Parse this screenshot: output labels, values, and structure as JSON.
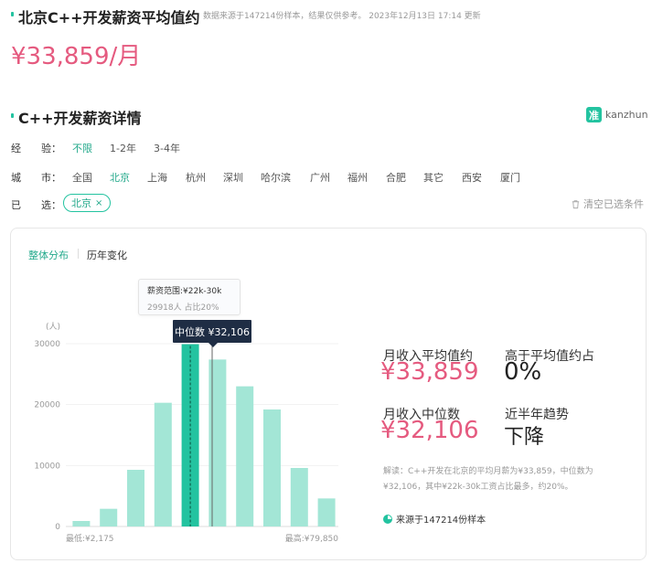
{
  "header": {
    "title": "北京C++开发薪资平均值约",
    "note": "数据来源于147214份样本，结果仅供参考。  2023年12月13日 17:14 更新",
    "big_salary": "¥33,859/月"
  },
  "details": {
    "title": "C++开发薪资详情",
    "brand": {
      "mark": "准",
      "name": "kanzhun"
    }
  },
  "filters": {
    "experience": {
      "label": "经　　验：",
      "options": [
        "不限",
        "1-2年",
        "3-4年"
      ],
      "selected": 0
    },
    "city": {
      "label": "城　　市：",
      "options": [
        "全国",
        "北京",
        "上海",
        "杭州",
        "深圳",
        "哈尔滨",
        "广州",
        "福州",
        "合肥",
        "其它",
        "西安",
        "厦门"
      ],
      "selected": 1
    },
    "chosen": {
      "label": "已　　选：",
      "chip": "北京",
      "chip_close": "×",
      "clear": "清空已选条件"
    }
  },
  "tabs": [
    "整体分布",
    "历年变化"
  ],
  "active_tab": 0,
  "tooltip": {
    "title": "薪资范围:¥22k-30k",
    "detail": "29918人 占比20%"
  },
  "median_label": "中位数 ¥32,106",
  "stats": {
    "avg_label": "月收入平均值约",
    "avg_value": "¥33,859",
    "above_label": "高于平均值约占",
    "above_value": "0%",
    "median_label": "月收入中位数",
    "median_value": "¥32,106",
    "trend_label": "近半年趋势",
    "trend_value": "下降"
  },
  "description": "解读：C++开发在北京的平均月薪为¥33,859，中位数为¥32,106，其中¥22k-30k工资占比最多，约20%。",
  "source": "来源于147214份样本",
  "colors": {
    "accent": "#23c3a0",
    "bar": "#a3e6d6",
    "bar_highlight": "#23c3a0",
    "salary": "#e55a7f",
    "median_box": "#1f2d44"
  },
  "chart_data": {
    "type": "bar",
    "ylabel": "(人)",
    "yticks": [
      0,
      10000,
      20000,
      30000
    ],
    "ylim": [
      0,
      33000
    ],
    "values": [
      900,
      2900,
      9300,
      20300,
      29918,
      27400,
      23000,
      19200,
      9600,
      4600
    ],
    "highlight_index": 4,
    "min_label": "最低:¥2,175",
    "max_label": "最高:¥79,850"
  }
}
